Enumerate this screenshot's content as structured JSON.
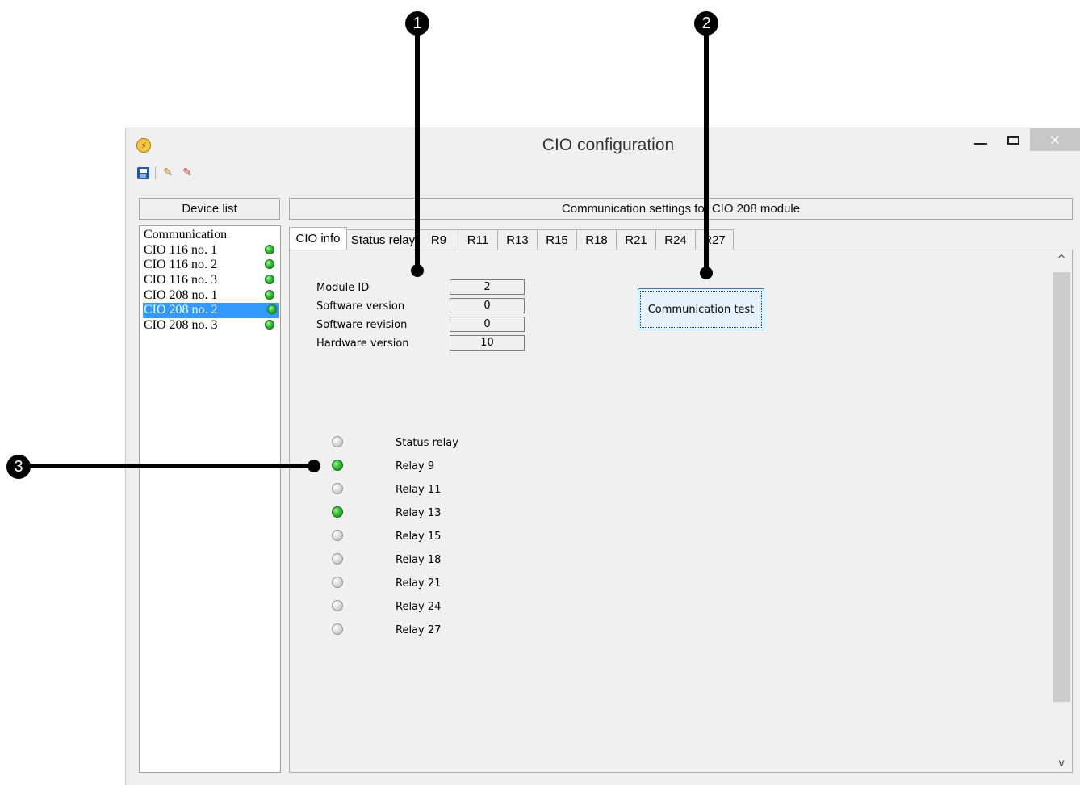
{
  "window": {
    "title": "CIO configuration",
    "close_glyph": "✕"
  },
  "toolbar": {
    "icons": [
      "save-icon",
      "edit-icon",
      "edit-reload-icon"
    ]
  },
  "device_list": {
    "header": "Device list",
    "items": [
      {
        "label": "Communication",
        "status": ""
      },
      {
        "label": "CIO 116 no. 1",
        "status": "on"
      },
      {
        "label": "CIO 116 no. 2",
        "status": "on"
      },
      {
        "label": "CIO 116 no. 3",
        "status": "on"
      },
      {
        "label": "CIO 208 no. 1",
        "status": "on"
      },
      {
        "label": "CIO 208 no. 2",
        "status": "on",
        "selected": true
      },
      {
        "label": "CIO 208 no. 3",
        "status": "on"
      }
    ]
  },
  "comm_panel": {
    "header": "Communication settings for CIO 208 module",
    "tabs": [
      "CIO info",
      "Status relay",
      "R9",
      "R11",
      "R13",
      "R15",
      "R18",
      "R21",
      "R24",
      "R27"
    ],
    "active_tab": "CIO info"
  },
  "cio_info": {
    "fields": [
      {
        "label": "Module ID",
        "value": "2"
      },
      {
        "label": "Software version",
        "value": "0"
      },
      {
        "label": "Software revision",
        "value": "0"
      },
      {
        "label": "Hardware version",
        "value": "10"
      }
    ],
    "test_button": "Communication test",
    "relays": [
      {
        "label": "Status relay",
        "state": "off"
      },
      {
        "label": "Relay 9",
        "state": "on"
      },
      {
        "label": "Relay 11",
        "state": "off"
      },
      {
        "label": "Relay 13",
        "state": "on"
      },
      {
        "label": "Relay 15",
        "state": "off"
      },
      {
        "label": "Relay 18",
        "state": "off"
      },
      {
        "label": "Relay 21",
        "state": "off"
      },
      {
        "label": "Relay 24",
        "state": "off"
      },
      {
        "label": "Relay 27",
        "state": "off"
      }
    ]
  },
  "scrollbar": {
    "up_glyph": "^",
    "down_glyph": "v"
  },
  "callouts": [
    "1",
    "2",
    "3"
  ],
  "colors": {
    "selection": "#3399ff",
    "led_on": "#2fbf2f",
    "led_off": "#d4d4d4"
  }
}
